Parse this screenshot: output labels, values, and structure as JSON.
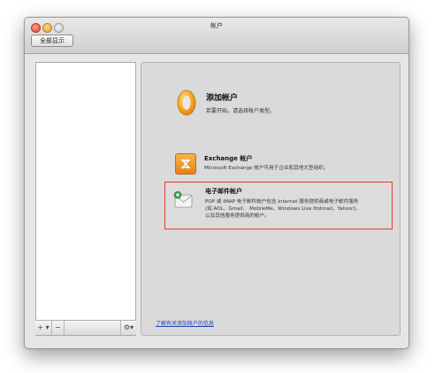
{
  "window": {
    "title": "帐户"
  },
  "toolbar": {
    "show_all_label": "全部显示"
  },
  "sidebar_toolbar": {
    "add_label": "+ ▾",
    "remove_label": "−",
    "gear_label": "⚙▾"
  },
  "add_account": {
    "title": "添加帐户",
    "subtitle": "若要开始，请选择帐户类型。"
  },
  "exchange": {
    "title": "Exchange 帐户",
    "description": "Microsoft Exchange 帐户可用于企业和其他大型组织。"
  },
  "email": {
    "title": "电子邮件帐户",
    "description_line1": "POP 或 IMAP 电子邮件帐户包含 Internet 服务提供商或电子邮件服务",
    "description_line2": "(如 AOL、Gmail、 MobileMe、Windows Live Hotmail、Yahoo!),",
    "description_line3": "以及其他服务提供商的帐户。"
  },
  "learn_more": {
    "label": "了解有关添加帐户的信息"
  },
  "colors": {
    "highlight": "#e23a2d",
    "link": "#2047b4",
    "exchange_icon": "#f39c2a"
  }
}
